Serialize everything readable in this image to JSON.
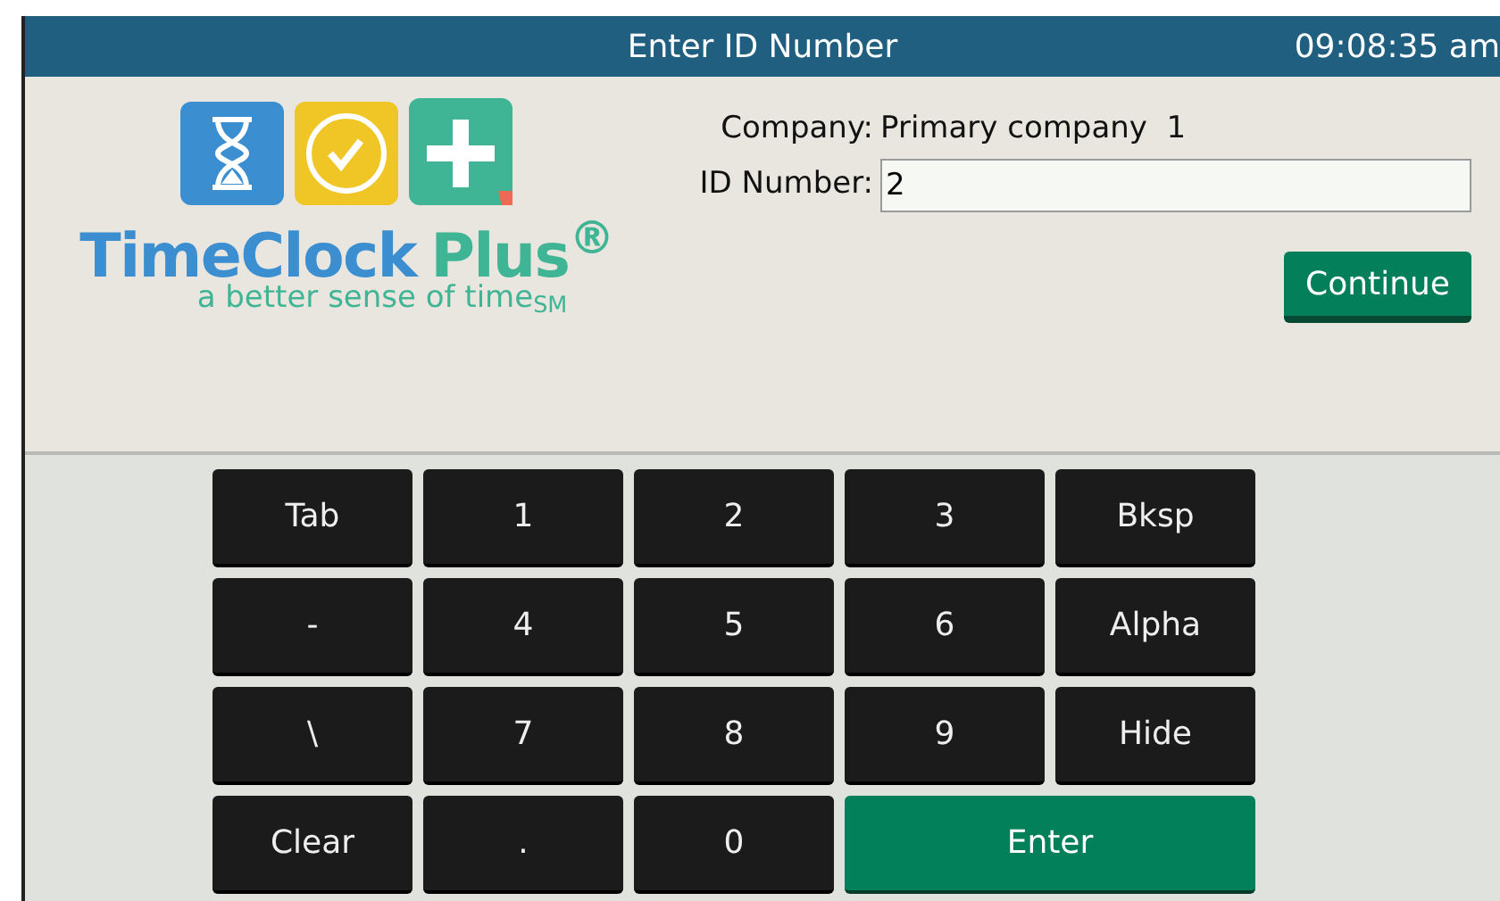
{
  "header": {
    "title": "Enter ID Number",
    "time": "09:08:35 am"
  },
  "logo": {
    "brand": "TimeClock",
    "brand_accent": "Plus$^{®}$",
    "tagline": "a better sense of time$_{SM}$"
  },
  "form": {
    "company_label": "Company:",
    "company_value": "Primary company  1",
    "id_label": "ID Number:",
    "id_value": "2",
    "continue": "Continue"
  },
  "keys": [
    {
      "label": "Tab",
      "kind": "key"
    },
    {
      "label": "1",
      "kind": "key"
    },
    {
      "label": "2",
      "kind": "key"
    },
    {
      "label": "3",
      "kind": "key"
    },
    {
      "label": "Bksp",
      "kind": "key"
    },
    {
      "label": "-",
      "kind": "key"
    },
    {
      "label": "4",
      "kind": "key"
    },
    {
      "label": "5",
      "kind": "key"
    },
    {
      "label": "6",
      "kind": "key"
    },
    {
      "label": "Alpha",
      "kind": "key"
    },
    {
      "label": "\\",
      "kind": "key"
    },
    {
      "label": "7",
      "kind": "key"
    },
    {
      "label": "8",
      "kind": "key"
    },
    {
      "label": "9",
      "kind": "key"
    },
    {
      "label": "Hide",
      "kind": "key"
    },
    {
      "label": "Clear",
      "kind": "key"
    },
    {
      "label": ".",
      "kind": "key"
    },
    {
      "label": "0",
      "kind": "key"
    },
    {
      "label": "Enter",
      "kind": "enter"
    }
  ]
}
